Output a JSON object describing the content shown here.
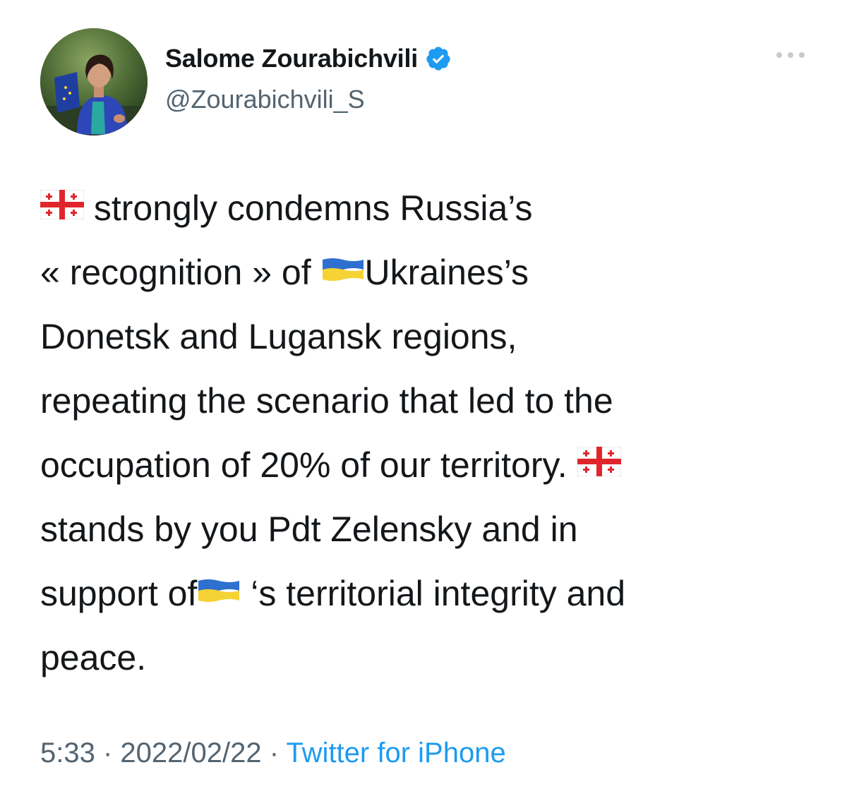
{
  "author": {
    "name": "Salome Zourabichvili",
    "handle": "@Zourabichvili_S",
    "verified": true,
    "avatar_icon": "profile-photo"
  },
  "tweet": {
    "segments": [
      {
        "type": "flag",
        "name": "georgia-flag-icon"
      },
      {
        "type": "text",
        "text": " strongly condemns Russia’s "
      },
      {
        "type": "break"
      },
      {
        "type": "text",
        "text": "« recognition » of "
      },
      {
        "type": "flag",
        "name": "ukraine-flag-icon"
      },
      {
        "type": "text",
        "text": "Ukraines’s"
      },
      {
        "type": "break"
      },
      {
        "type": "text",
        "text": "Donetsk and Lugansk regions,"
      },
      {
        "type": "break"
      },
      {
        "type": "text",
        "text": "repeating the scenario that led to the"
      },
      {
        "type": "break"
      },
      {
        "type": "text",
        "text": "occupation of 20% of our territory. "
      },
      {
        "type": "flag",
        "name": "georgia-flag-icon"
      },
      {
        "type": "break"
      },
      {
        "type": "text",
        "text": "stands by you Pdt Zelensky and in"
      },
      {
        "type": "break"
      },
      {
        "type": "text",
        "text": "support of"
      },
      {
        "type": "flag",
        "name": "ukraine-flag-icon"
      },
      {
        "type": "text",
        "text": " ‘s territorial integrity and"
      },
      {
        "type": "break"
      },
      {
        "type": "text",
        "text": "peace."
      }
    ]
  },
  "meta": {
    "time": "5:33",
    "separator": " · ",
    "date": "2022/02/22",
    "source": "Twitter for iPhone"
  },
  "colors": {
    "text": "#14171a",
    "secondary": "#536471",
    "link": "#1d9bf0",
    "verified": "#1d9bf0",
    "ukraine_blue": "#2f6fd0",
    "ukraine_yellow": "#f6d335",
    "georgia_red": "#e0262c"
  },
  "more_icon": "more-horizontal-icon"
}
